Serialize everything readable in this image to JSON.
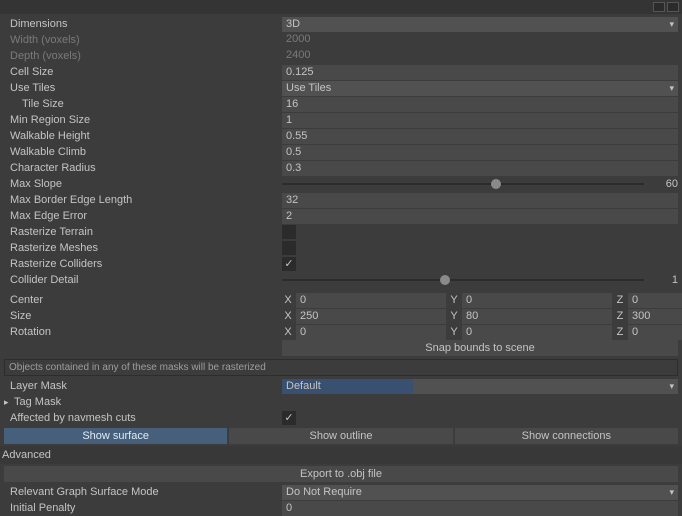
{
  "props": {
    "dimensions": {
      "label": "Dimensions",
      "value": "3D"
    },
    "width": {
      "label": "Width (voxels)",
      "value": "2000"
    },
    "depth": {
      "label": "Depth (voxels)",
      "value": "2400"
    },
    "cellSize": {
      "label": "Cell Size",
      "value": "0.125"
    },
    "useTiles": {
      "label": "Use Tiles",
      "value": "Use Tiles"
    },
    "tileSize": {
      "label": "Tile Size",
      "value": "16"
    },
    "minRegionSize": {
      "label": "Min Region Size",
      "value": "1"
    },
    "walkableHeight": {
      "label": "Walkable Height",
      "value": "0.55"
    },
    "walkableClimb": {
      "label": "Walkable Climb",
      "value": "0.5"
    },
    "characterRadius": {
      "label": "Character Radius",
      "value": "0.3"
    },
    "maxSlope": {
      "label": "Max Slope",
      "value": "60",
      "pct": 59
    },
    "maxBorderEdgeLength": {
      "label": "Max Border Edge Length",
      "value": "32"
    },
    "maxEdgeError": {
      "label": "Max Edge Error",
      "value": "2"
    },
    "rasterizeTerrain": {
      "label": "Rasterize Terrain"
    },
    "rasterizeMeshes": {
      "label": "Rasterize Meshes"
    },
    "rasterizeColliders": {
      "label": "Rasterize Colliders"
    },
    "colliderDetail": {
      "label": "Collider Detail",
      "value": "1",
      "pct": 45
    },
    "center": {
      "label": "Center",
      "x": "0",
      "y": "0",
      "z": "0"
    },
    "size": {
      "label": "Size",
      "x": "250",
      "y": "80",
      "z": "300"
    },
    "rotation": {
      "label": "Rotation",
      "x": "0",
      "y": "0",
      "z": "0"
    },
    "snapBtn": "Snap bounds to scene",
    "maskNote": "Objects contained in any of these masks will be rasterized",
    "layerMask": {
      "label": "Layer Mask",
      "value": "Default",
      "fillPct": 33
    },
    "tagMask": {
      "label": "Tag Mask"
    },
    "affectedByNavmesh": {
      "label": "Affected by navmesh cuts"
    },
    "showBtns": {
      "surface": "Show surface",
      "outline": "Show outline",
      "connections": "Show connections"
    },
    "advancedHeader": "Advanced",
    "exportBtn": "Export to .obj file",
    "graphSurfaceMode": {
      "label": "Relevant Graph Surface Mode",
      "value": "Do Not Require"
    },
    "initialPenalty": {
      "label": "Initial Penalty",
      "value": "0"
    }
  },
  "axis": {
    "x": "X",
    "y": "Y",
    "z": "Z"
  }
}
